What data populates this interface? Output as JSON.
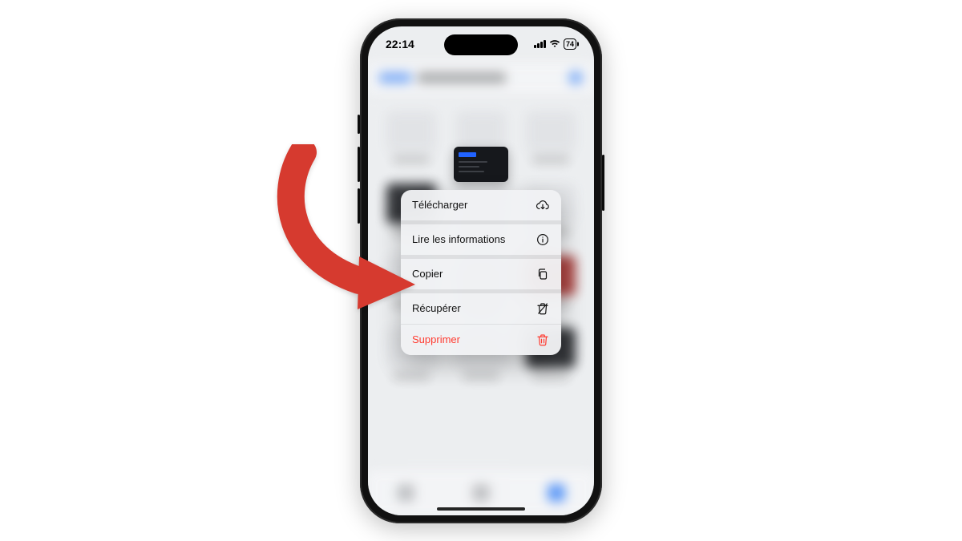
{
  "status": {
    "time": "22:14",
    "battery": "74"
  },
  "menu": {
    "items": [
      {
        "label": "Télécharger",
        "icon": "cloud-download-icon",
        "destructive": false
      },
      {
        "label": "Lire les informations",
        "icon": "info-icon",
        "destructive": false
      },
      {
        "label": "Copier",
        "icon": "copy-icon",
        "destructive": false
      },
      {
        "label": "Récupérer",
        "icon": "trash-restore-icon",
        "destructive": false
      },
      {
        "label": "Supprimer",
        "icon": "trash-icon",
        "destructive": true
      }
    ]
  },
  "colors": {
    "destructive": "#ff3b30",
    "arrow": "#d63a2f",
    "accent": "#2f7cf6"
  }
}
